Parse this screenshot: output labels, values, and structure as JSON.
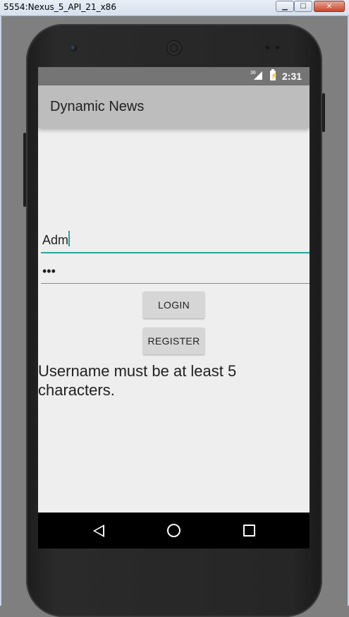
{
  "window": {
    "title": "5554:Nexus_5_API_21_x86",
    "minimize_icon": "minimize-icon",
    "maximize_icon": "maximize-icon",
    "close_icon": "close-icon"
  },
  "statusbar": {
    "network": "36",
    "time": "2:31"
  },
  "appbar": {
    "title": "Dynamic News"
  },
  "form": {
    "username_value": "Adm",
    "password_value": "•••",
    "login_label": "LOGIN",
    "register_label": "REGISTER",
    "error_message": "Username must be at least 5 characters."
  },
  "colors": {
    "accent": "#26a69a",
    "appbar": "#bdbdbd",
    "statusbar": "#757575",
    "background": "#eeeeee"
  }
}
